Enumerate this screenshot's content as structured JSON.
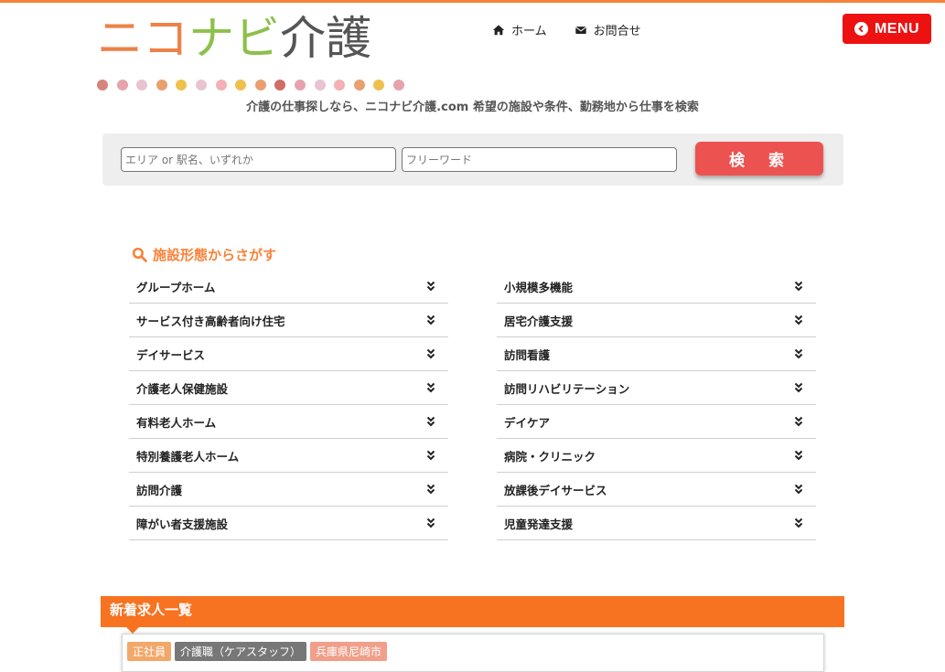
{
  "logo": {
    "chars": [
      {
        "text": "ニコ",
        "color": "#ec8247"
      },
      {
        "text": "ナビ",
        "color": "#8dc04a"
      },
      {
        "text": "介護",
        "color": "#555555"
      }
    ],
    "dot_colors": [
      "#d6847c",
      "#e6a3ad",
      "#e8c3d0",
      "#e8a071",
      "#f0c04f",
      "#e8c3d0",
      "#f3b0b5",
      "#f0c04f",
      "#e8a071",
      "#cf6d66",
      "#e6a3ad",
      "#e8c3d0",
      "#f3b0b5",
      "#e8a071",
      "#f0c04f",
      "#e6a3ad"
    ]
  },
  "nav": {
    "home": "ホーム",
    "contact": "お問合せ"
  },
  "menu_label": "MENU",
  "tagline": "介護の仕事探しなら、ニコナビ介護.com  希望の施設や条件、勤務地から仕事を検索",
  "search": {
    "area_placeholder": "エリア or 駅名、いずれか",
    "free_placeholder": "フリーワード",
    "button": "検 索"
  },
  "facility_section": {
    "title": "施設形態からさがす",
    "left": [
      "グループホーム",
      "サービス付き高齢者向け住宅",
      "デイサービス",
      "介護老人保健施設",
      "有料老人ホーム",
      "特別養護老人ホーム",
      "訪問介護",
      "障がい者支援施設"
    ],
    "right": [
      "小規模多機能",
      "居宅介護支援",
      "訪問看護",
      "訪問リハビリテーション",
      "デイケア",
      "病院・クリニック",
      "放課後デイサービス",
      "児童発達支援"
    ]
  },
  "new_jobs": {
    "title": "新着求人一覧",
    "tags": [
      {
        "text": "正社員",
        "color": "#f3a86b"
      },
      {
        "text": "介護職（ケアスタッフ）",
        "color": "#777777"
      },
      {
        "text": "兵庫県尼崎市",
        "color": "#f09f8a"
      }
    ]
  },
  "colors": {
    "accent": "#f7833a",
    "menu_red": "#ee1111",
    "search_btn": "#ec5350"
  }
}
